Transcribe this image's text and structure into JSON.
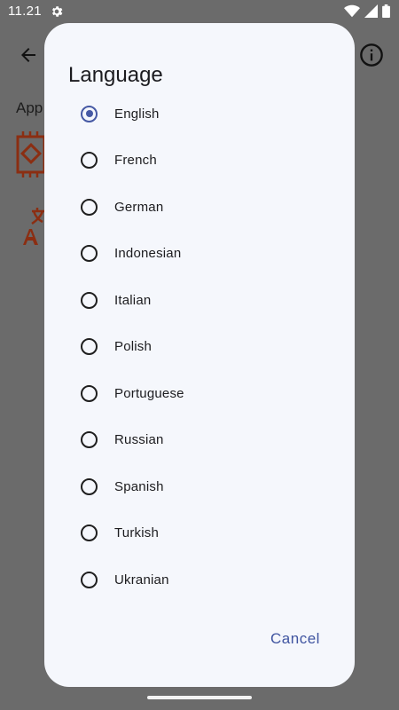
{
  "status_bar": {
    "time": "11.21",
    "icons": [
      "settings-icon",
      "wifi-icon",
      "signal-icon",
      "battery-icon"
    ]
  },
  "background": {
    "section_label": "App",
    "icons": [
      "back-arrow-icon",
      "info-icon",
      "chip-icon",
      "translate-icon"
    ],
    "icon_color": "#8b2e12"
  },
  "dialog": {
    "title": "Language",
    "options": [
      {
        "label": "English",
        "selected": true
      },
      {
        "label": "French",
        "selected": false
      },
      {
        "label": "German",
        "selected": false
      },
      {
        "label": "Indonesian",
        "selected": false
      },
      {
        "label": "Italian",
        "selected": false
      },
      {
        "label": "Polish",
        "selected": false
      },
      {
        "label": "Portuguese",
        "selected": false
      },
      {
        "label": "Russian",
        "selected": false
      },
      {
        "label": "Spanish",
        "selected": false
      },
      {
        "label": "Turkish",
        "selected": false
      },
      {
        "label": "Ukranian",
        "selected": false
      }
    ],
    "cancel_label": "Cancel"
  },
  "colors": {
    "scrim": "#6b6b6b",
    "dialog_bg": "#f5f7fc",
    "accent": "#4659a4"
  }
}
